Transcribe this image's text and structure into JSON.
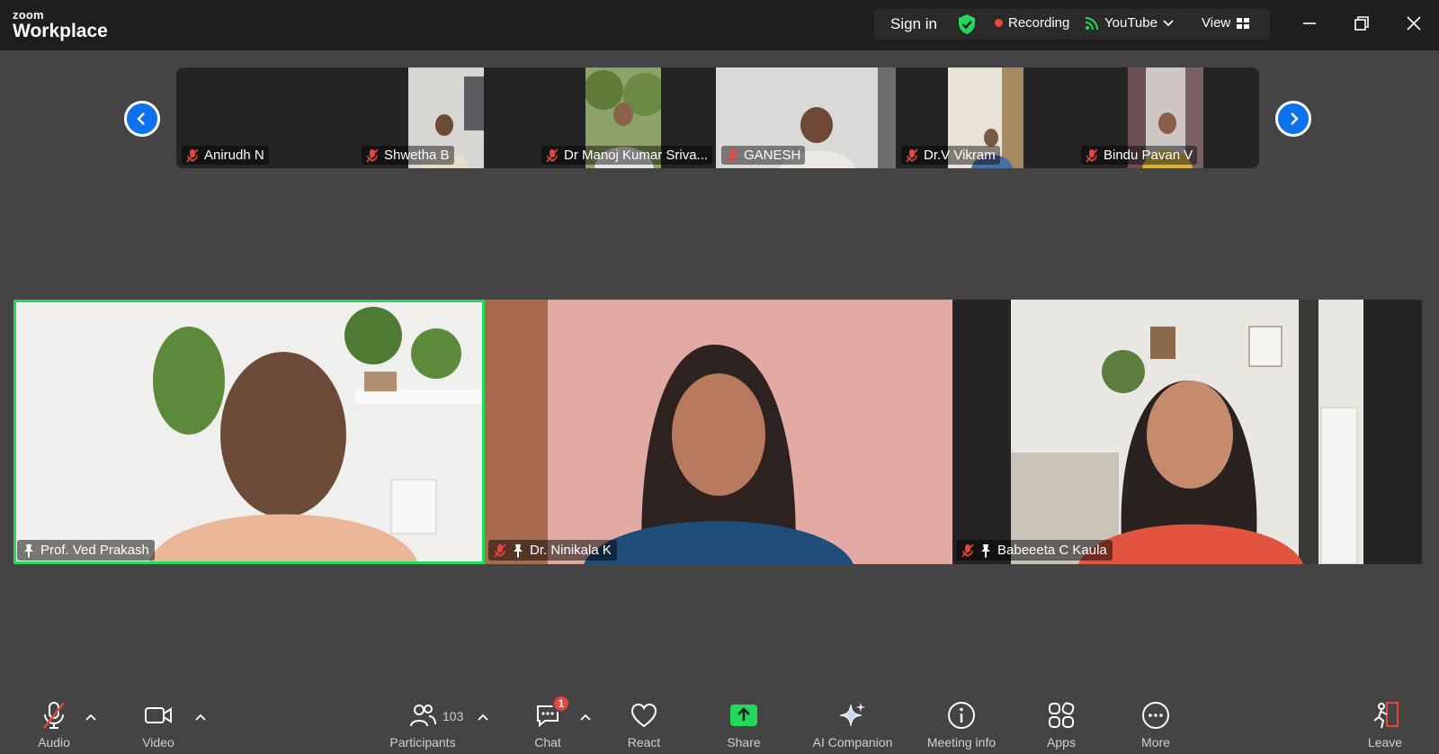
{
  "app": {
    "brand_top": "zoom",
    "brand_bottom": "Workplace"
  },
  "titlebar": {
    "sign_in": "Sign in",
    "recording": "Recording",
    "stream": "YouTube",
    "view": "View"
  },
  "strip": {
    "participants": [
      {
        "name": "Anirudh N",
        "has_video": false,
        "muted": true
      },
      {
        "name": "Shwetha B",
        "has_video": true,
        "muted": true
      },
      {
        "name": "Dr Manoj Kumar Sriva...",
        "has_video": true,
        "muted": true
      },
      {
        "name": "GANESH",
        "has_video": true,
        "muted": true
      },
      {
        "name": "Dr.V Vikram",
        "has_video": true,
        "muted": true
      },
      {
        "name": "Bindu Pavan V",
        "has_video": true,
        "muted": true
      }
    ]
  },
  "tiles": [
    {
      "name": "Prof. Ved Prakash",
      "muted": false,
      "pinned": true,
      "active": true
    },
    {
      "name": "Dr. Ninikala K",
      "muted": true,
      "pinned": true,
      "active": false
    },
    {
      "name": "Babeeeta C Kaula",
      "muted": true,
      "pinned": true,
      "active": false
    }
  ],
  "toolbar": {
    "audio": "Audio",
    "video": "Video",
    "participants": "Participants",
    "participants_count": "103",
    "chat": "Chat",
    "chat_badge": "1",
    "react": "React",
    "share": "Share",
    "ai_companion": "AI Companion",
    "meeting_info": "Meeting info",
    "apps": "Apps",
    "more": "More",
    "leave": "Leave"
  },
  "colors": {
    "accent_blue": "#0e72ed",
    "active_speaker": "#23d959",
    "recording_red": "#e8453c",
    "share_green": "#23d959",
    "background": "#444444"
  }
}
